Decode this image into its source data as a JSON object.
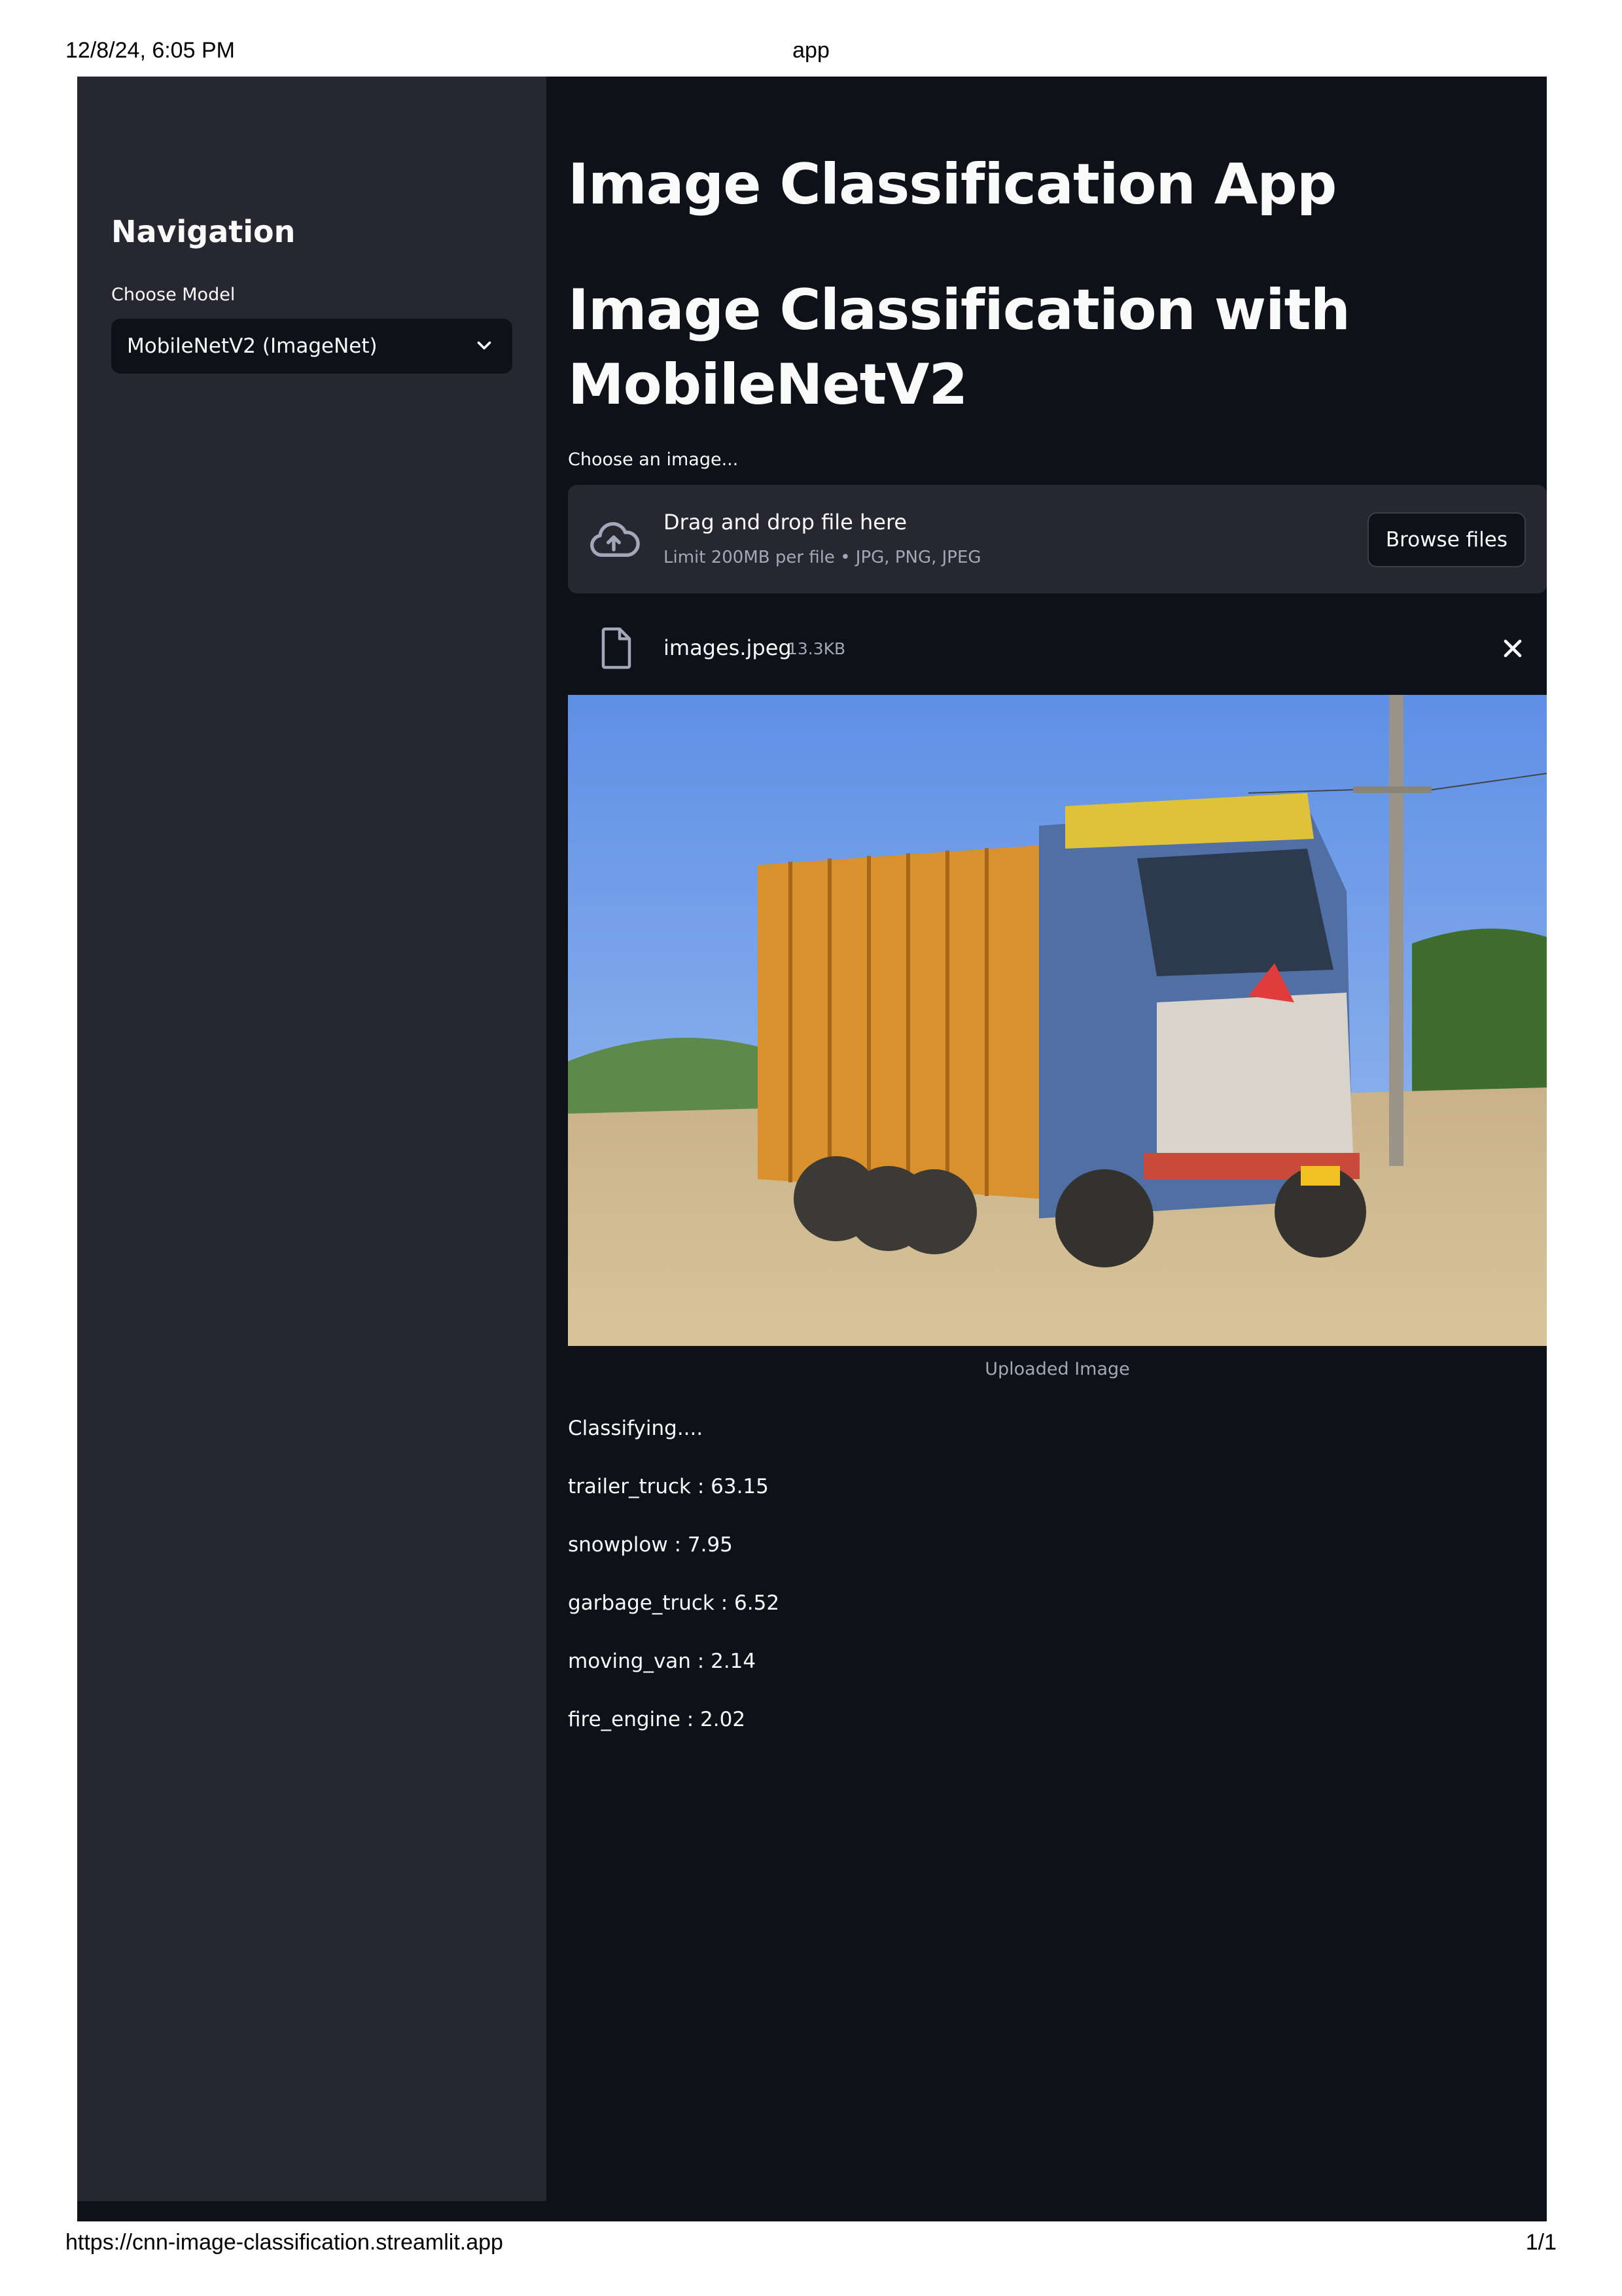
{
  "print_header": {
    "datetime": "12/8/24, 6:05 PM",
    "page_title": "app"
  },
  "print_footer": {
    "url": "https://cnn-image-classification.streamlit.app",
    "page_number": "1/1"
  },
  "sidebar": {
    "title": "Navigation",
    "model_select": {
      "label": "Choose Model",
      "selected": "MobileNetV2 (ImageNet)",
      "icon": "chevron-down-icon"
    }
  },
  "main": {
    "title": "Image Classification App",
    "subtitle": "Image Classification with MobileNetV2",
    "uploader": {
      "label": "Choose an image...",
      "drop_text": "Drag and drop file here",
      "limit_text": "Limit 200MB per file • JPG, PNG, JPEG",
      "browse_label": "Browse files",
      "icon": "cloud-upload-icon"
    },
    "uploaded_file": {
      "name": "images.jpeg",
      "size": "13.3KB",
      "icon": "file-icon",
      "remove_icon": "close-icon"
    },
    "image": {
      "caption": "Uploaded Image"
    },
    "status": "Classifying....",
    "predictions": [
      "trailer_truck : 63.15",
      "snowplow : 7.95",
      "garbage_truck : 6.52",
      "moving_van : 2.14",
      "fire_engine : 2.02"
    ]
  },
  "colors": {
    "app_background": "#0e1117",
    "sidebar_background": "#262730",
    "text_primary": "#fafafa",
    "text_secondary": "#a3a8b8"
  }
}
